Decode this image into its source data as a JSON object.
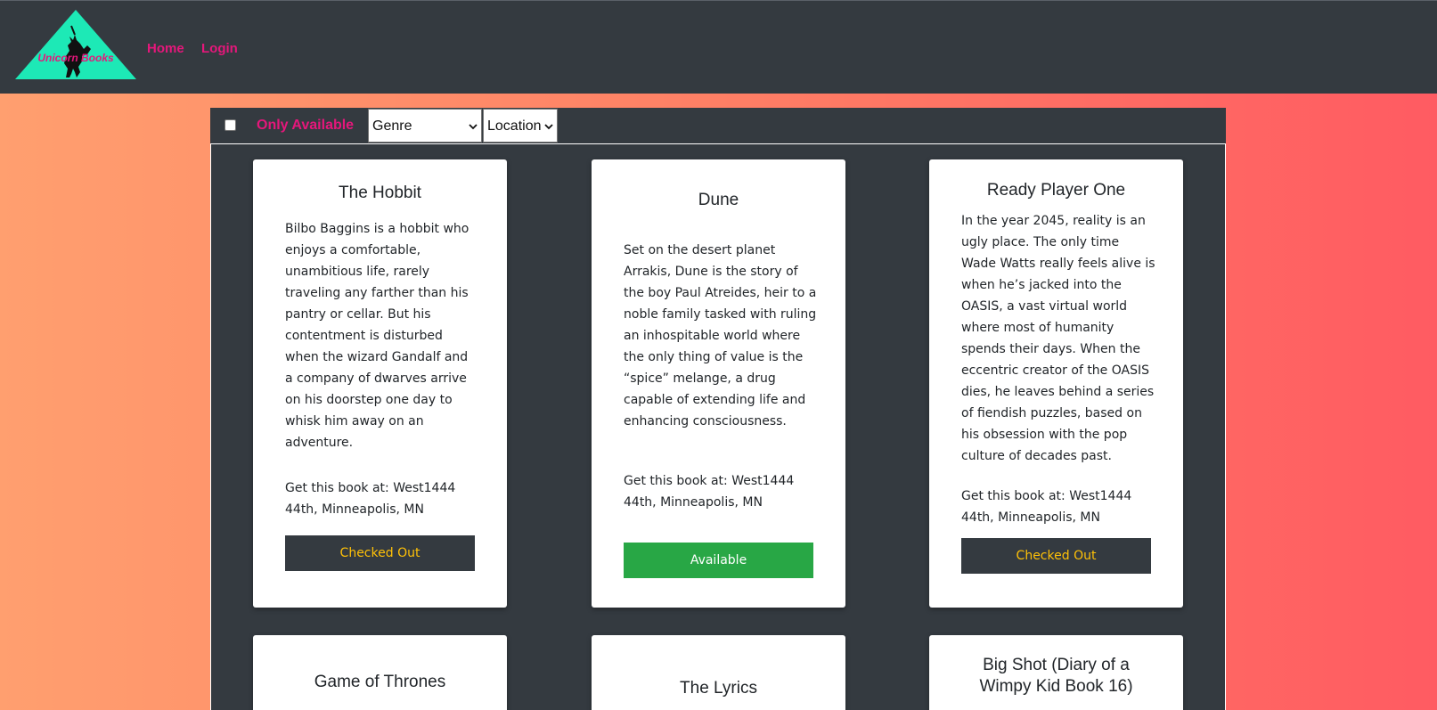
{
  "brand": {
    "logo_text": "Unicorn Books",
    "logo_color": "#1de9b6",
    "accent": "#e5177b"
  },
  "nav": {
    "home": "Home",
    "login": "Login"
  },
  "filters": {
    "only_available_label": "Only Available",
    "only_available_checked": false,
    "genre_selected": "Genre",
    "location_selected": "Location"
  },
  "books": [
    {
      "title": "The Hobbit",
      "description": "Bilbo Baggins is a hobbit who enjoys a comfortable, unambitious life, rarely traveling any farther than his pantry or cellar. But his contentment is disturbed when the wizard Gandalf and a company of dwarves arrive on his doorstep one day to whisk him away on an adventure.",
      "location": "Get this book at: West1444 44th, Minneapolis, MN",
      "status": "Checked Out"
    },
    {
      "title": "Dune",
      "description": "Set on the desert planet Arrakis, Dune is the story of the boy Paul Atreides, heir to a noble family tasked with ruling an inhospitable world where the only thing of value is the “spice” melange, a drug capable of extending life and enhancing consciousness.",
      "location": "Get this book at: West1444 44th, Minneapolis, MN",
      "status": "Available"
    },
    {
      "title": "Ready Player One",
      "description": "In the year 2045, reality is an ugly place. The only time Wade Watts really feels alive is when he’s jacked into the OASIS, a vast virtual world where most of humanity spends their days. When the eccentric creator of the OASIS dies, he leaves behind a series of fiendish puzzles, based on his obsession with the pop culture of decades past.",
      "location": "Get this book at: West1444 44th, Minneapolis, MN",
      "status": "Checked Out"
    },
    {
      "title": "Game of Thrones"
    },
    {
      "title": "The Lyrics"
    },
    {
      "title": "Big Shot (Diary of a Wimpy Kid Book 16)"
    }
  ]
}
